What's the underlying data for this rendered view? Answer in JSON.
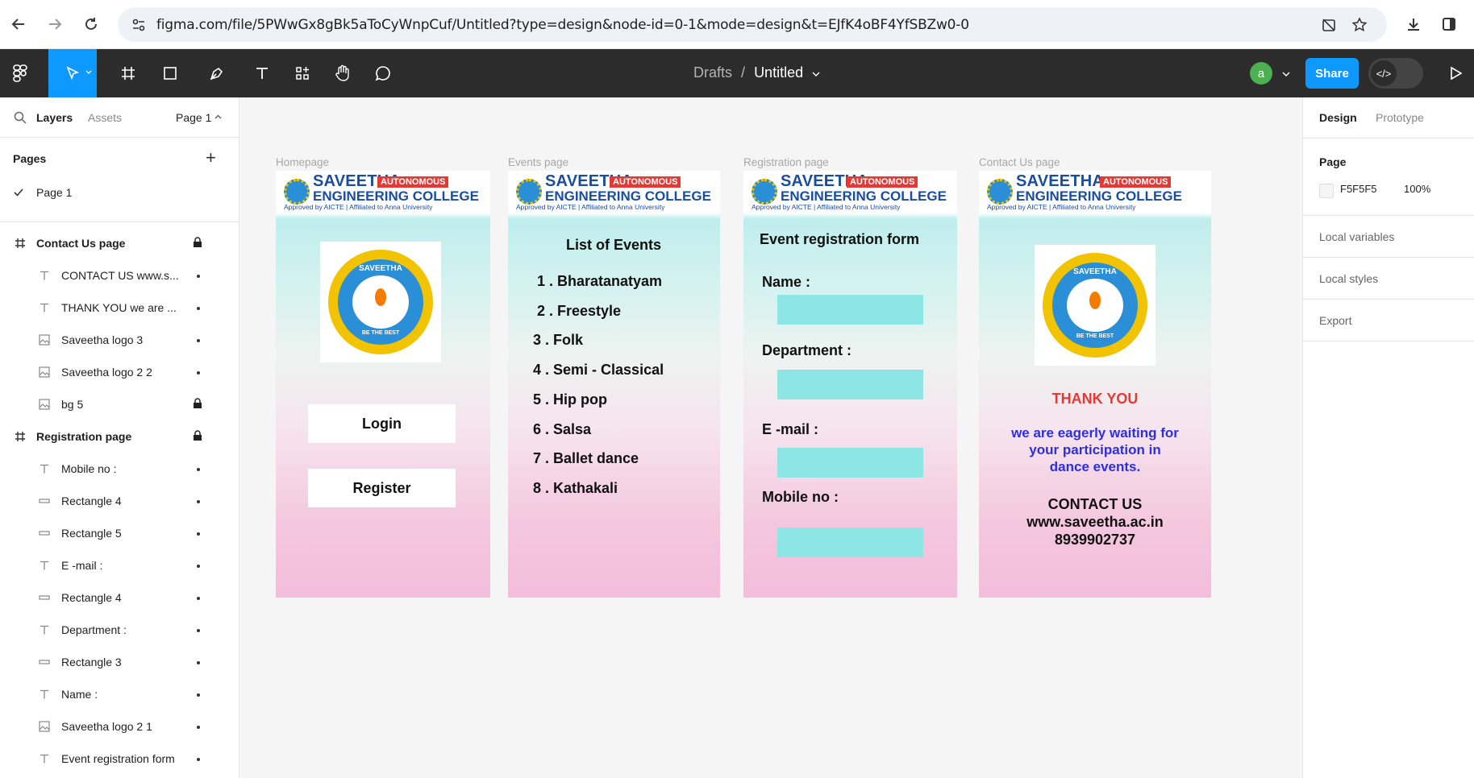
{
  "browser": {
    "url": "figma.com/file/5PWwGx8gBk5aToCyWnpCuf/Untitled?type=design&node-id=0-1&mode=design&t=EJfK4oBF4YfSBZw0-0"
  },
  "toolbar": {
    "breadcrumb_drafts": "Drafts",
    "breadcrumb_sep": "/",
    "file_name": "Untitled",
    "avatar_letter": "a",
    "share_label": "Share",
    "dev_mode_label": "</>",
    "accent_color": "#0d99ff"
  },
  "left_panel": {
    "tabs": {
      "layers": "Layers",
      "assets": "Assets",
      "page": "Page 1"
    },
    "pages_header": "Pages",
    "add_icon": "+",
    "current_page": "Page 1",
    "layers": [
      {
        "name": "Contact Us page",
        "type": "frame",
        "locked": true
      },
      {
        "name": "CONTACT US www.s...",
        "type": "text"
      },
      {
        "name": "THANK YOU we are ...",
        "type": "text"
      },
      {
        "name": "Saveetha logo 3",
        "type": "image"
      },
      {
        "name": "Saveetha logo 2 2",
        "type": "image"
      },
      {
        "name": "bg 5",
        "type": "image",
        "locked": true
      },
      {
        "name": "Registration page",
        "type": "frame",
        "locked": true
      },
      {
        "name": "Mobile no :",
        "type": "text"
      },
      {
        "name": "Rectangle 4",
        "type": "rect"
      },
      {
        "name": "Rectangle 5",
        "type": "rect"
      },
      {
        "name": "E -mail :",
        "type": "text"
      },
      {
        "name": "Rectangle 4",
        "type": "rect"
      },
      {
        "name": "Department :",
        "type": "text"
      },
      {
        "name": "Rectangle 3",
        "type": "rect"
      },
      {
        "name": "Name :",
        "type": "text"
      },
      {
        "name": "Saveetha logo 2 1",
        "type": "image"
      },
      {
        "name": "Event registration form",
        "type": "text"
      }
    ]
  },
  "canvas": {
    "background": "#F5F5F5",
    "banner": {
      "title": "SAVEETHA",
      "subtitle": "ENGINEERING COLLEGE",
      "badge": "AUTONOMOUS",
      "tagline": "Approved by AICTE | Affiliated to Anna University"
    },
    "logo": {
      "top_text": "SAVEETHA",
      "bottom_text": "BE THE BEST"
    },
    "homepage": {
      "label": "Homepage",
      "login": "Login",
      "register": "Register"
    },
    "events": {
      "label": "Events page",
      "title": "List of Events",
      "items": [
        "1 .  Bharatanatyam",
        "2 . Freestyle",
        "3 . Folk",
        "4 . Semi - Classical",
        "5 . Hip pop",
        "6 . Salsa",
        "7 . Ballet dance",
        "8 . Kathakali"
      ]
    },
    "registration": {
      "label": "Registration page",
      "title": "Event  registration form",
      "name": "Name :",
      "department": "Department :",
      "email": "E -mail :",
      "mobile": "Mobile no :"
    },
    "contact": {
      "label": "Contact Us page",
      "thank_you": "THANK YOU",
      "message_1": "we are eagerly waiting for",
      "message_2": "your participation in",
      "message_3": "dance events.",
      "contact_us": "CONTACT US",
      "website": "www.saveetha.ac.in",
      "phone": "8939902737",
      "thank_color": "#e53935",
      "message_color": "#2d2ee0"
    }
  },
  "right_panel": {
    "tabs": {
      "design": "Design",
      "prototype": "Prototype"
    },
    "page_header": "Page",
    "page_color_hex": "F5F5F5",
    "page_opacity": "100%",
    "local_variables": "Local variables",
    "local_styles": "Local styles",
    "export": "Export"
  }
}
